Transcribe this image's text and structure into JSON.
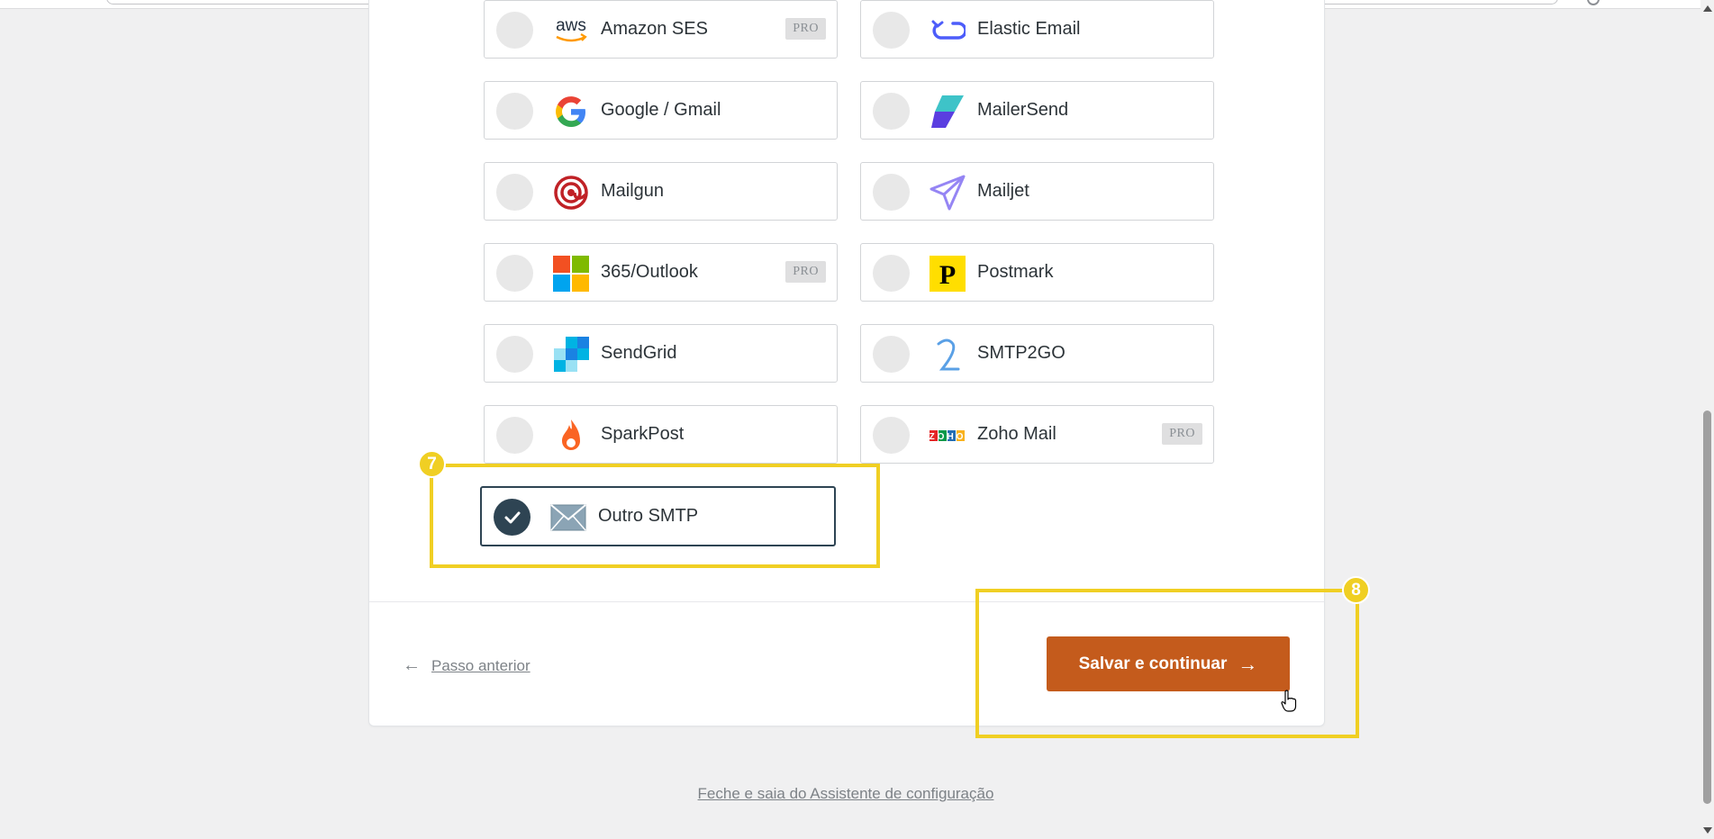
{
  "colors": {
    "accent": "#c45b1c",
    "selected": "#2e4453",
    "highlight": "#f0cf23",
    "background": "#f0f0f1"
  },
  "mailers": [
    {
      "id": "amazon-ses",
      "label": "Amazon SES",
      "icon": "aws-logo-icon",
      "pro": true,
      "selected": false
    },
    {
      "id": "elastic-email",
      "label": "Elastic Email",
      "icon": "elastic-email-icon",
      "pro": false,
      "selected": false
    },
    {
      "id": "google-gmail",
      "label": "Google / Gmail",
      "icon": "google-icon",
      "pro": false,
      "selected": false
    },
    {
      "id": "mailersend",
      "label": "MailerSend",
      "icon": "mailersend-icon",
      "pro": false,
      "selected": false
    },
    {
      "id": "mailgun",
      "label": "Mailgun",
      "icon": "mailgun-icon",
      "pro": false,
      "selected": false
    },
    {
      "id": "mailjet",
      "label": "Mailjet",
      "icon": "mailjet-icon",
      "pro": false,
      "selected": false
    },
    {
      "id": "outlook",
      "label": "365/Outlook",
      "icon": "microsoft-icon",
      "pro": true,
      "selected": false
    },
    {
      "id": "postmark",
      "label": "Postmark",
      "icon": "postmark-icon",
      "pro": false,
      "selected": false
    },
    {
      "id": "sendgrid",
      "label": "SendGrid",
      "icon": "sendgrid-icon",
      "pro": false,
      "selected": false
    },
    {
      "id": "smtp2go",
      "label": "SMTP2GO",
      "icon": "smtp2go-icon",
      "pro": false,
      "selected": false
    },
    {
      "id": "sparkpost",
      "label": "SparkPost",
      "icon": "sparkpost-flame-icon",
      "pro": false,
      "selected": false
    },
    {
      "id": "zoho",
      "label": "Zoho Mail",
      "icon": "zoho-icon",
      "pro": true,
      "selected": false
    },
    {
      "id": "other-smtp",
      "label": "Outro SMTP",
      "icon": "envelope-icon",
      "pro": false,
      "selected": true
    }
  ],
  "pro_label": "PRO",
  "aws_logo_text": "aws",
  "postmark_logo_text": "P",
  "zoho_logo_text": "ZOHO",
  "annotations": {
    "badge_7": "7",
    "badge_8": "8"
  },
  "footer": {
    "back_label": "Passo anterior",
    "back_arrow": "←",
    "save_label": "Salvar e continuar",
    "save_arrow": "→",
    "exit_label": "Feche e saia do Assistente de configuração"
  }
}
